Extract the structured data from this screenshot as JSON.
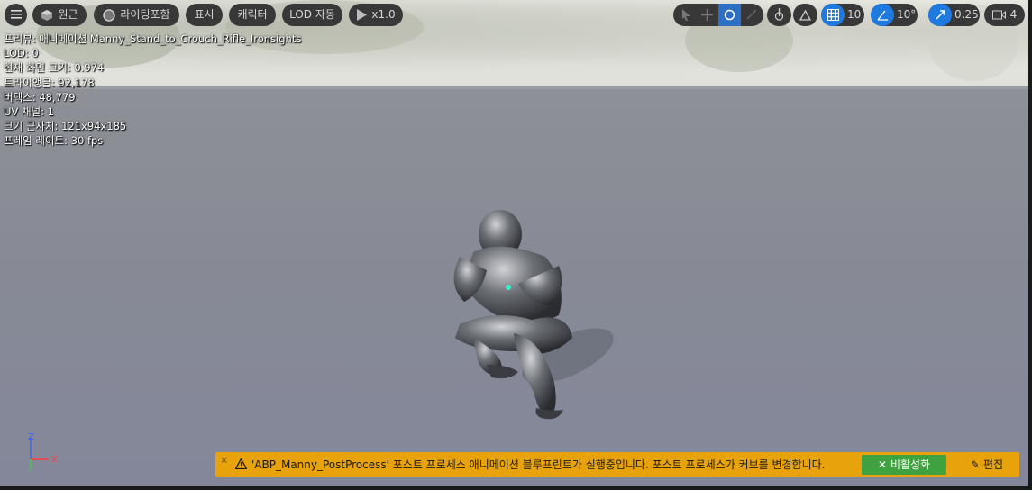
{
  "toolbar": {
    "menu_icon": "hamburger-icon",
    "perspective_label": "원근",
    "lighting_label": "라이팅포함",
    "show_label": "표시",
    "character_label": "캐릭터",
    "lod_label": "LOD 자동",
    "playback_label": "x1.0",
    "grid_snap_value": "10",
    "rotation_snap_value": "10°",
    "scale_snap_value": "0.25",
    "camera_speed_value": "4"
  },
  "stats": {
    "preview": "프리뷰: 애니메이션 Manny_Stand_to_Crouch_Rifle_Ironsights",
    "lod": "LOD: 0",
    "screen_size": "현재 화면 크기: 0.974",
    "triangles": "트라이앵글: 92,178",
    "vertices": "버텍스: 48,779",
    "uv_channels": "UV 채널: 1",
    "approx_size": "크기 근사치: 121x94x185",
    "frame_rate": "프레임 레이트: 30 fps"
  },
  "axis": {
    "x": "X",
    "y": "Y",
    "z": "Z"
  },
  "notice": {
    "close": "×",
    "message": "'ABP_Manny_PostProcess' 포스트 프로세스 애니메이션 블루프린트가 실행중입니다. 포스트 프로세스가 커브를 변경합니다.",
    "disable_label": "비활성화",
    "edit_label": "편집"
  },
  "colors": {
    "toolbar_bg": "#383838",
    "accent_blue": "#1f7ae0",
    "notice_bg": "#e8a20c",
    "disable_green": "#3fa13f"
  }
}
